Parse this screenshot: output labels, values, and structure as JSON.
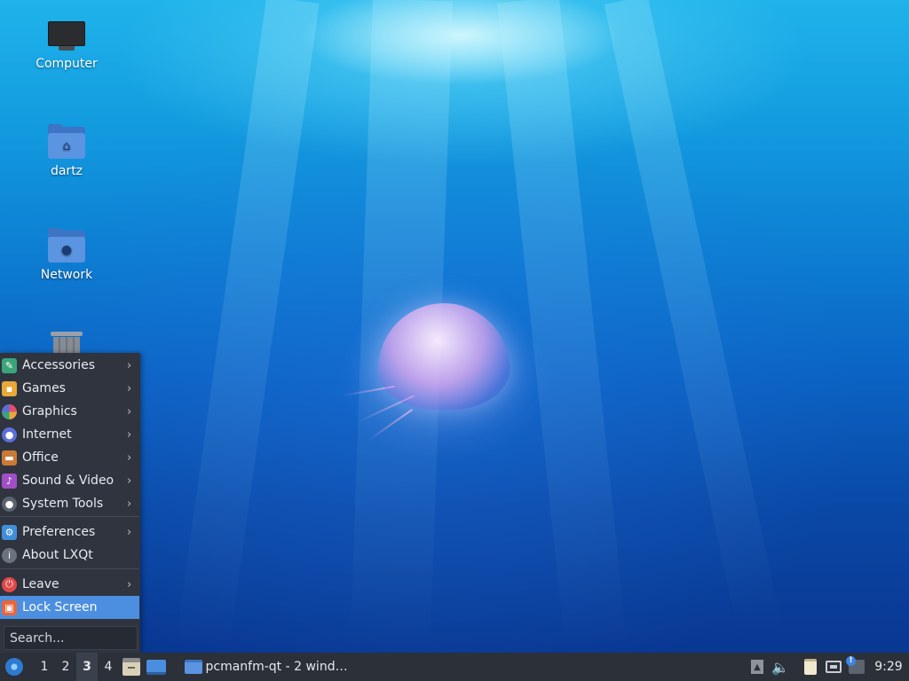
{
  "desktop": {
    "icons": [
      {
        "label": "Computer",
        "icon": "computer-icon"
      },
      {
        "label": "dartz",
        "icon": "home-folder-icon"
      },
      {
        "label": "Network",
        "icon": "network-folder-icon"
      },
      {
        "label": "",
        "icon": "trash-icon"
      }
    ]
  },
  "start_menu": {
    "items": [
      {
        "label": "Accessories",
        "icon": "accessories-icon",
        "submenu": true
      },
      {
        "label": "Games",
        "icon": "games-icon",
        "submenu": true
      },
      {
        "label": "Graphics",
        "icon": "graphics-icon",
        "submenu": true
      },
      {
        "label": "Internet",
        "icon": "internet-icon",
        "submenu": true
      },
      {
        "label": "Office",
        "icon": "office-icon",
        "submenu": true
      },
      {
        "label": "Sound & Video",
        "icon": "sound-video-icon",
        "submenu": true
      },
      {
        "label": "System Tools",
        "icon": "system-tools-icon",
        "submenu": true
      },
      {
        "label": "Preferences",
        "icon": "preferences-icon",
        "submenu": true
      },
      {
        "label": "About LXQt",
        "icon": "about-icon",
        "submenu": false
      },
      {
        "label": "Leave",
        "icon": "leave-icon",
        "submenu": true
      },
      {
        "label": "Lock Screen",
        "icon": "lock-icon",
        "submenu": false,
        "selected": true
      }
    ],
    "submenu_arrow": "›",
    "search_placeholder": "Search..."
  },
  "taskbar": {
    "desktops": [
      "1",
      "2",
      "3",
      "4"
    ],
    "active_desktop": "3",
    "task_label": "pcmanfm-qt - 2 windo…",
    "clock": "9:29",
    "volume_glyph": "🔈",
    "eject_glyph": "▲"
  },
  "colors": {
    "menu_bg": "#2f343f",
    "menu_selected": "#4c8fe0",
    "taskbar_bg": "#2b3039",
    "accessories": "#3aa57a",
    "games": "#e8a93a",
    "graphics": "#e0506e",
    "internet": "#5a6fd8",
    "office": "#c97a36",
    "sound_video": "#a04fc6",
    "system_tools": "#5a6270",
    "preferences": "#3f8fd8",
    "about": "#6b717d",
    "leave": "#e04848",
    "lock": "#e8663a"
  }
}
